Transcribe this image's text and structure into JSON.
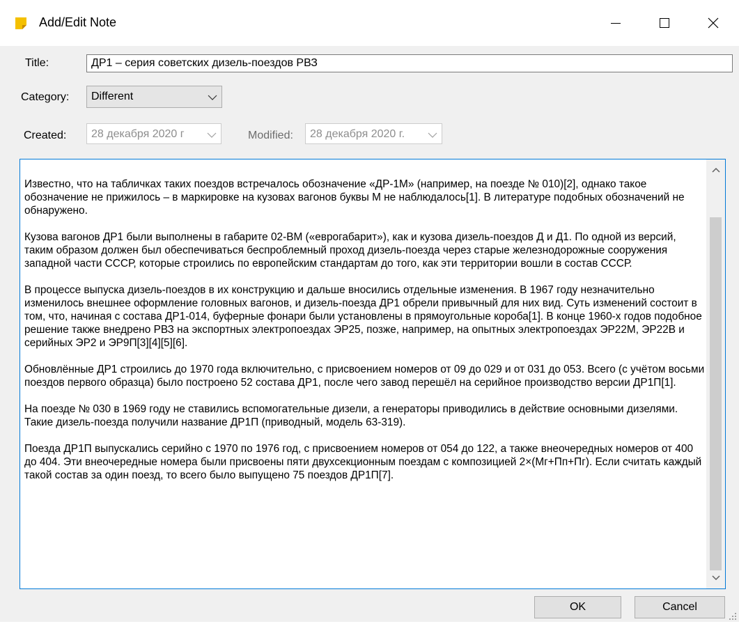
{
  "window": {
    "title": "Add/Edit Note",
    "controls": {
      "minimize": "minimize-icon",
      "maximize": "maximize-icon",
      "close": "close-icon"
    },
    "icon": "sticky-note-icon",
    "icon_color": "#f4c000"
  },
  "form": {
    "title_label": "Title:",
    "title_value": "ДР1 – серия советских дизель-поездов РВЗ",
    "category_label": "Category:",
    "category_value": "Different",
    "created_label": "Created:",
    "created_value": "28 декабря  2020 г",
    "modified_label": "Modified:",
    "modified_value": "28 декабря  2020 г."
  },
  "editor": {
    "paragraphs": [
      "Известно, что на табличках таких поездов встречалось обозначение «ДР-1М» (например, на поезде № 010)[2], однако такое обозначение не прижилось – в маркировке на кузовах вагонов буквы М не наблюдалось[1]. В литературе подобных обозначений не обнаружено.",
      "Кузова вагонов ДР1 были выполнены в габарите 02-ВМ («еврогабарит»), как и кузова дизель-поездов Д и Д1. По одной из версий, таким образом должен был обеспечиваться беспроблемный проход дизель-поезда через старые железнодорожные сооружения западной части СССР, которые строились по европейским стандартам до того, как эти территории вошли в состав СССР.",
      "В процессе выпуска дизель-поездов в их конструкцию и дальше вносились отдельные изменения. В 1967 году незначительно изменилось внешнее оформление головных вагонов, и дизель-поезда ДР1 обрели привычный для них вид. Суть изменений состоит в том, что, начиная с состава ДР1-014, буферные фонари были установлены в прямоугольные короба[1]. В конце 1960-х годов подобное решение также внедрено РВЗ на экспортных электропоездах ЭР25, позже, например, на опытных электропоездах ЭР22М, ЭР22В и серийных ЭР2 и ЭР9П[3][4][5][6].",
      "Обновлённые ДР1 строились до 1970 года включительно, с присвоением номеров от 09 до 029 и от 031 до 053. Всего (с учётом восьми поездов первого образца) было построено 52 состава ДР1, после чего завод перешёл на серийное производство версии ДР1П[1].",
      "На поезде № 030 в 1969 году не ставились вспомогательные дизели, а генераторы приводились в действие основными дизелями. Такие дизель-поезда получили название ДР1П (приводный, модель 63-319).",
      "Поезда ДР1П выпускались серийно с 1970 по 1976 год, с присвоением номеров от 054 до 122, а также внеочередных номеров от 400 до 404. Эти внеочередные номера были присвоены пяти двухсекционным поездам с композицией 2×(Мг+Пп+Пг). Если считать каждый такой состав за один поезд, то всего было выпущено 75 поездов ДР1П[7]."
    ],
    "focus_color": "#0078d7"
  },
  "buttons": {
    "ok": "OK",
    "cancel": "Cancel"
  }
}
